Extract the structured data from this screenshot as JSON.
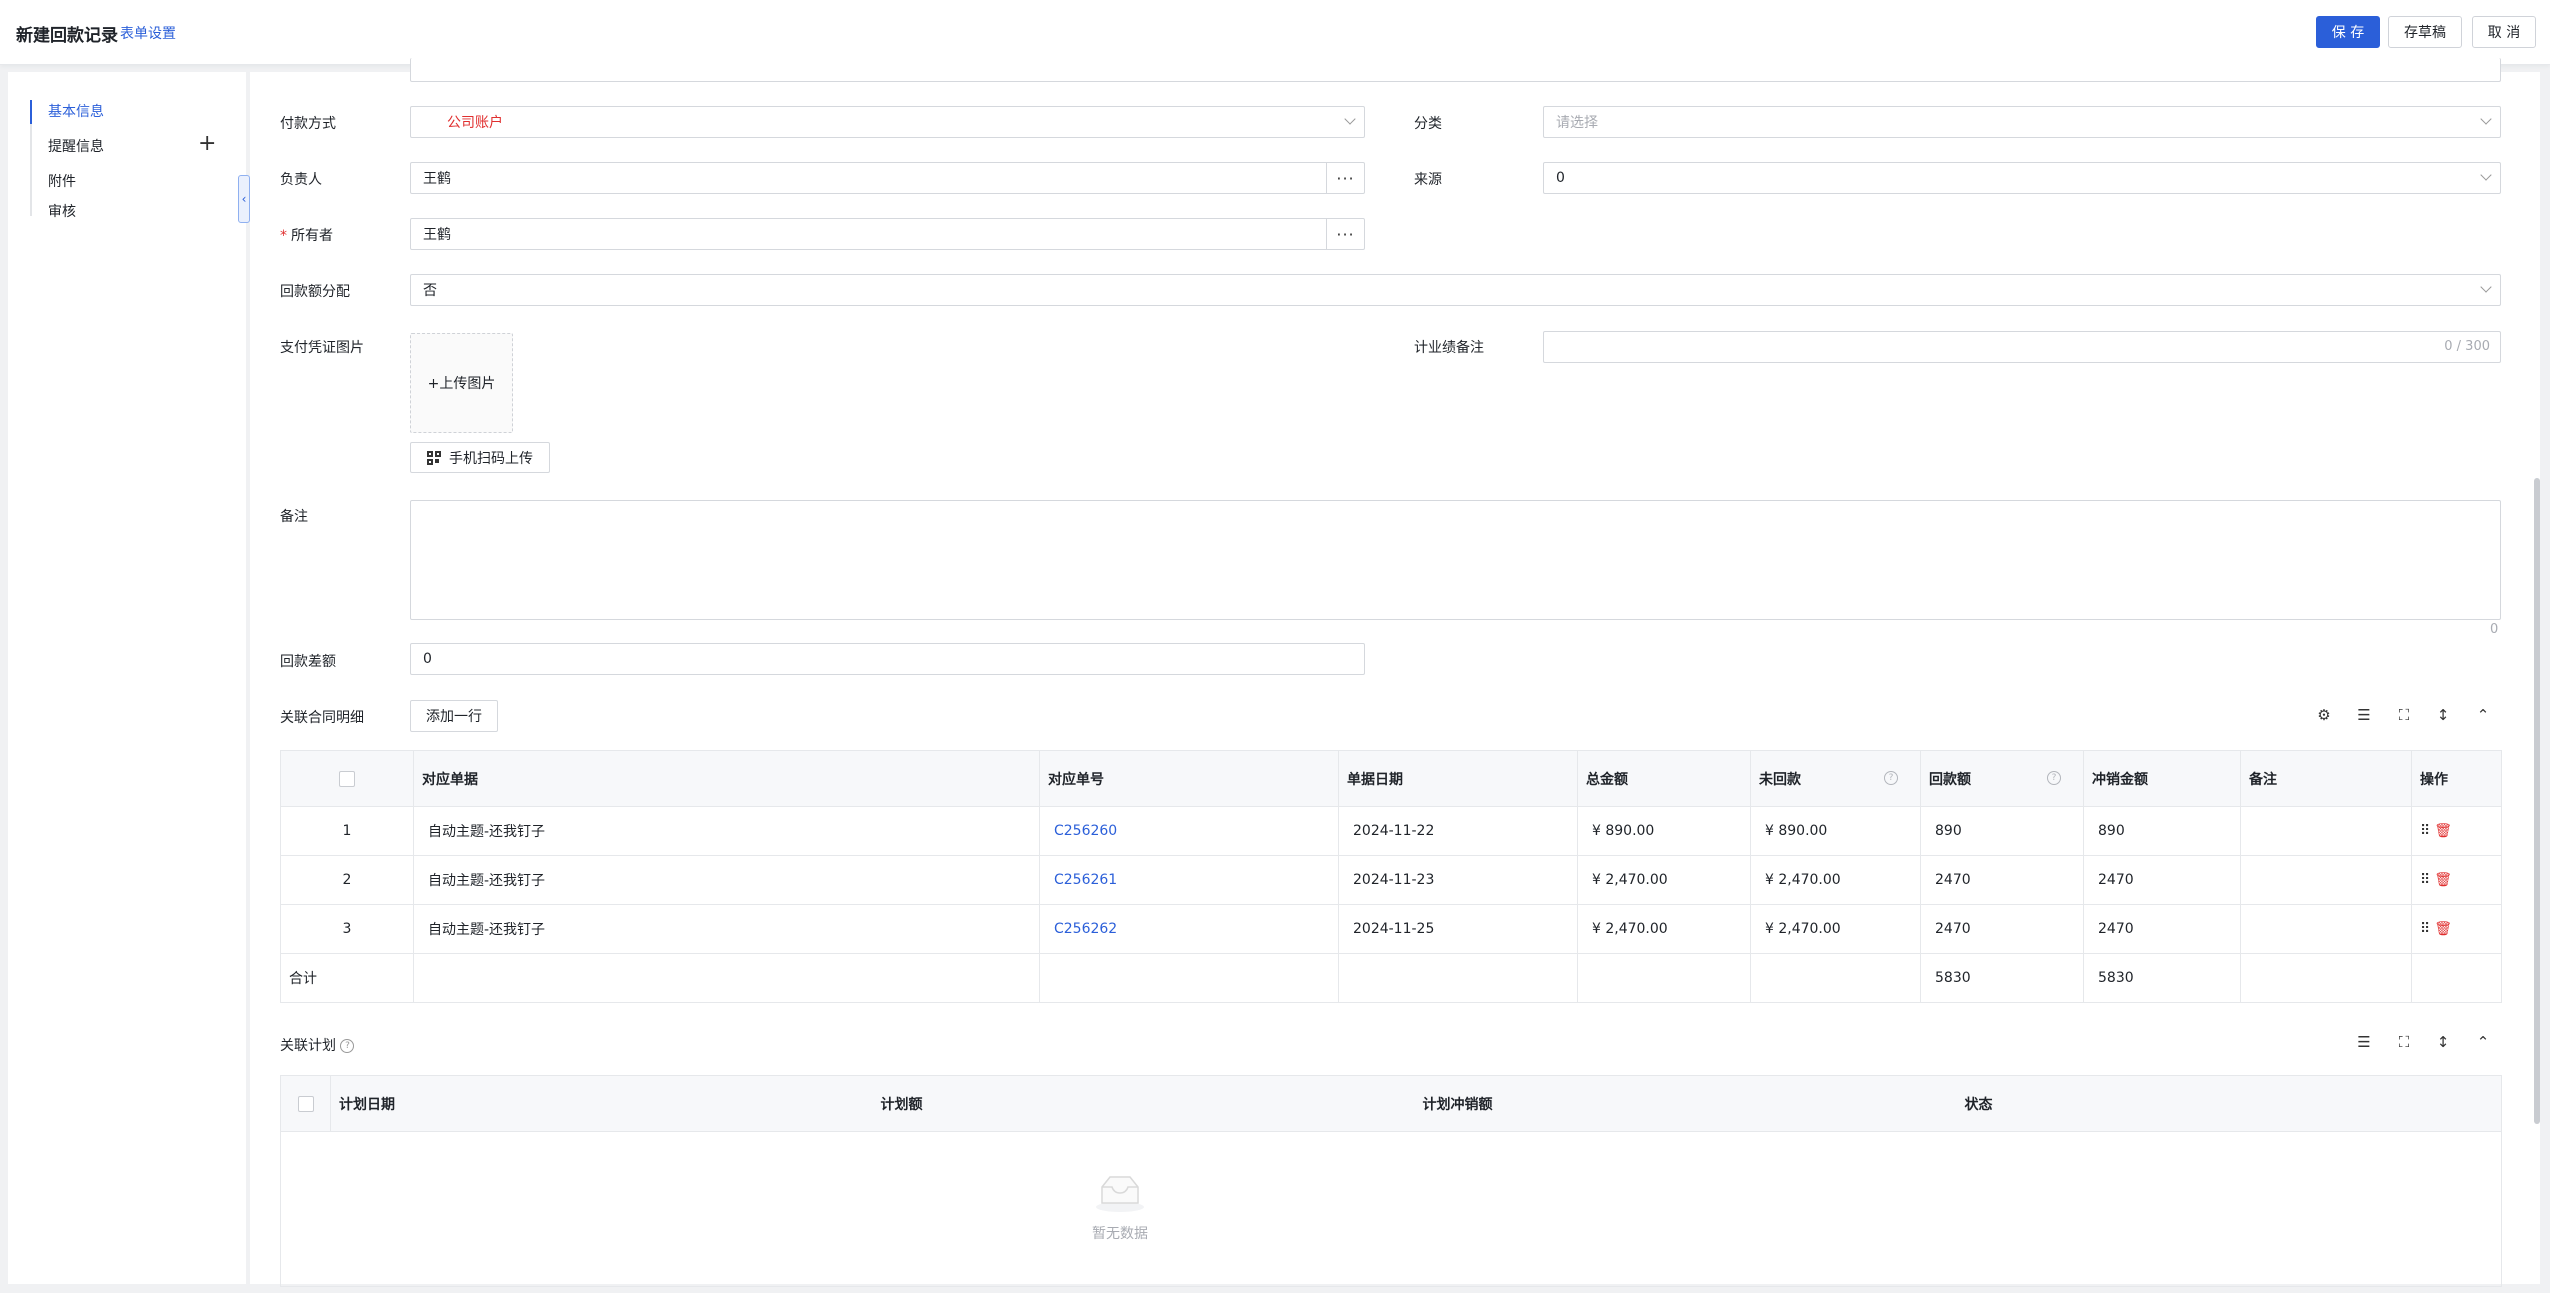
{
  "header": {
    "title": "新建回款记录",
    "settings_link": "表单设置",
    "save_label": "保 存",
    "draft_label": "存草稿",
    "cancel_label": "取 消"
  },
  "sidebar": {
    "items": [
      {
        "label": "基本信息"
      },
      {
        "label": "提醒信息"
      },
      {
        "label": "附件"
      },
      {
        "label": "审核"
      }
    ],
    "plus": "+",
    "collapse": "‹"
  },
  "form": {
    "payment_method": {
      "label": "付款方式",
      "value": "公司账户"
    },
    "category": {
      "label": "分类",
      "placeholder": "请选择"
    },
    "owner_responsible": {
      "label": "负责人",
      "value": "王鹤"
    },
    "source": {
      "label": "来源",
      "value": "0"
    },
    "owner": {
      "required": "*",
      "label": "所有者",
      "value": "王鹤"
    },
    "allocation": {
      "label": "回款额分配",
      "value": "否"
    },
    "voucher": {
      "label": "支付凭证图片",
      "upload": "+上传图片",
      "scan": "手机扫码上传"
    },
    "perf_note": {
      "label": "计业绩备注",
      "counter": "0 / 300"
    },
    "remark": {
      "label": "备注",
      "counter": "0"
    },
    "difference": {
      "label": "回款差额",
      "value": "0"
    },
    "more": "···"
  },
  "contract_detail": {
    "title": "关联合同明细",
    "add_row": "添加一行",
    "columns": [
      "对应单据",
      "对应单号",
      "单据日期",
      "总金额",
      "未回款",
      "回款额",
      "冲销金额",
      "备注",
      "操作"
    ],
    "help": "?",
    "rows": [
      {
        "idx": "1",
        "doc": "自动主题-还我钉子",
        "no": "C256260",
        "date": "2024-11-22",
        "total": "¥ 890.00",
        "unpaid": "¥ 890.00",
        "paid": "890",
        "offset": "890",
        "remark": ""
      },
      {
        "idx": "2",
        "doc": "自动主题-还我钉子",
        "no": "C256261",
        "date": "2024-11-23",
        "total": "¥ 2,470.00",
        "unpaid": "¥ 2,470.00",
        "paid": "2470",
        "offset": "2470",
        "remark": ""
      },
      {
        "idx": "3",
        "doc": "自动主题-还我钉子",
        "no": "C256262",
        "date": "2024-11-25",
        "total": "¥ 2,470.00",
        "unpaid": "¥ 2,470.00",
        "paid": "2470",
        "offset": "2470",
        "remark": ""
      }
    ],
    "total_label": "合计",
    "total_paid": "5830",
    "total_offset": "5830"
  },
  "plan": {
    "title": "关联计划",
    "help": "?",
    "columns": [
      "计划日期",
      "计划额",
      "计划冲销额",
      "状态"
    ],
    "empty": "暂无数据"
  }
}
